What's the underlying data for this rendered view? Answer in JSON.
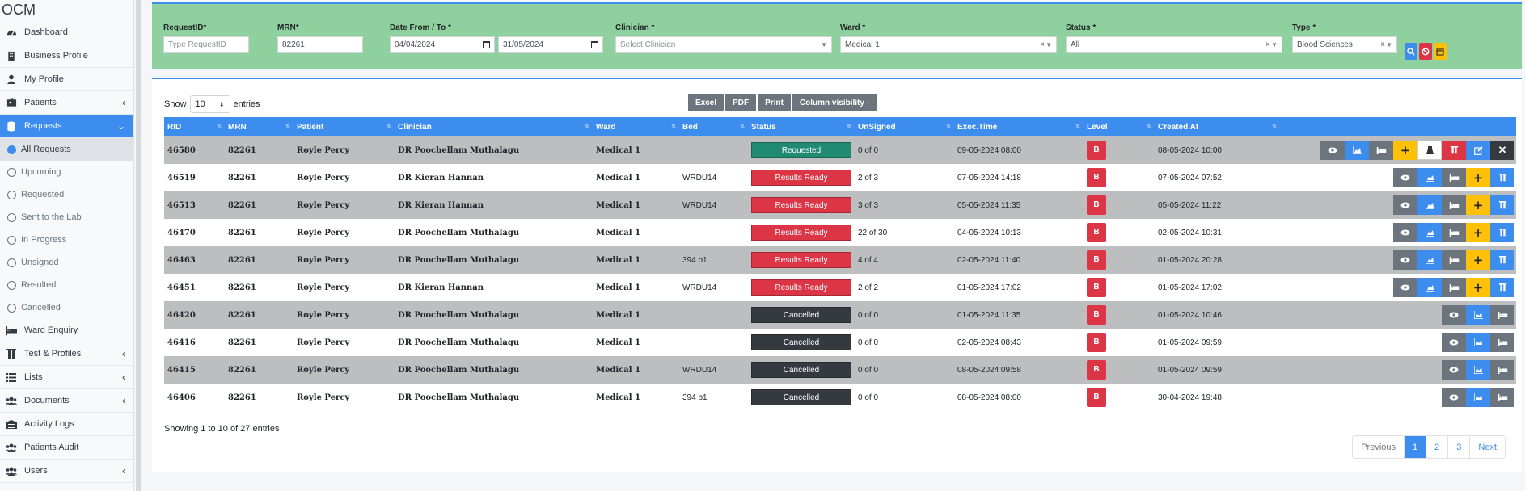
{
  "brand": "OCM",
  "sidebar": {
    "items": [
      {
        "label": "Dashboard",
        "icon": "dashboard-icon"
      },
      {
        "label": "Business Profile",
        "icon": "building-icon"
      },
      {
        "label": "My Profile",
        "icon": "user-icon"
      },
      {
        "label": "Patients",
        "icon": "patients-icon",
        "chevron": "‹"
      },
      {
        "label": "Requests",
        "icon": "database-icon",
        "chevron": "⌄"
      }
    ],
    "sub_items": [
      {
        "label": "All Requests"
      },
      {
        "label": "Upcoming"
      },
      {
        "label": "Requested"
      },
      {
        "label": "Sent to the Lab"
      },
      {
        "label": "In Progress"
      },
      {
        "label": "Unsigned"
      },
      {
        "label": "Resulted"
      },
      {
        "label": "Cancelled"
      }
    ],
    "items_after": [
      {
        "label": "Ward Enquiry",
        "icon": "bed-icon"
      },
      {
        "label": "Test & Profiles",
        "icon": "test-tubes-icon",
        "chevron": "‹"
      },
      {
        "label": "Lists",
        "icon": "list-icon",
        "chevron": "‹"
      },
      {
        "label": "Documents",
        "icon": "users-icon",
        "chevron": "‹"
      },
      {
        "label": "Activity Logs",
        "icon": "warehouse-icon"
      },
      {
        "label": "Patients Audit",
        "icon": "users-icon"
      },
      {
        "label": "Users",
        "icon": "users-icon",
        "chevron": "‹"
      }
    ]
  },
  "filters": {
    "request_id": {
      "label": "RequestID*",
      "placeholder": "Type RequestID",
      "value": ""
    },
    "mrn": {
      "label": "MRN*",
      "value": "82261"
    },
    "date": {
      "label": "Date From / To *",
      "from": "04/04/2024",
      "to": "31/05/2024"
    },
    "clinician": {
      "label": "Clinician *",
      "placeholder": "Select Clinician"
    },
    "ward": {
      "label": "Ward *",
      "value": "Medical 1"
    },
    "status": {
      "label": "Status *",
      "value": "All"
    },
    "type": {
      "label": "Type *",
      "value": "Blood Sciences"
    }
  },
  "table_controls": {
    "show": "Show",
    "entries_value": "10",
    "entries": "entries",
    "buttons": [
      "Excel",
      "PDF",
      "Print",
      "Column visibility -"
    ]
  },
  "columns": [
    "RID",
    "MRN",
    "Patient",
    "Clinician",
    "Ward",
    "Bed",
    "Status",
    "UnSigned",
    "Exec.Time",
    "Level",
    "Created At",
    ""
  ],
  "rows": [
    {
      "rid": "46580",
      "mrn": "82261",
      "patient": "Royle Percy",
      "clinician": "DR Poochellam Muthalagu",
      "ward": "Medical 1",
      "bed": "",
      "status": "Requested",
      "unsigned": "0 of 0",
      "exec": "09-05-2024 08:00",
      "level": "B",
      "created": "08-05-2024 10:00"
    },
    {
      "rid": "46519",
      "mrn": "82261",
      "patient": "Royle Percy",
      "clinician": "DR Kieran Hannan",
      "ward": "Medical 1",
      "bed": "WRDU14",
      "status": "Results Ready",
      "unsigned": "2 of 3",
      "exec": "07-05-2024 14:18",
      "level": "B",
      "created": "07-05-2024 07:52"
    },
    {
      "rid": "46513",
      "mrn": "82261",
      "patient": "Royle Percy",
      "clinician": "DR Kieran Hannan",
      "ward": "Medical 1",
      "bed": "WRDU14",
      "status": "Results Ready",
      "unsigned": "3 of 3",
      "exec": "05-05-2024 11:35",
      "level": "B",
      "created": "05-05-2024 11:22"
    },
    {
      "rid": "46470",
      "mrn": "82261",
      "patient": "Royle Percy",
      "clinician": "DR Poochellam Muthalagu",
      "ward": "Medical 1",
      "bed": "",
      "status": "Results Ready",
      "unsigned": "22 of 30",
      "exec": "04-05-2024 10:13",
      "level": "B",
      "created": "02-05-2024 10:31"
    },
    {
      "rid": "46463",
      "mrn": "82261",
      "patient": "Royle Percy",
      "clinician": "DR Poochellam Muthalagu",
      "ward": "Medical 1",
      "bed": "394 b1",
      "status": "Results Ready",
      "unsigned": "4 of 4",
      "exec": "02-05-2024 11:40",
      "level": "B",
      "created": "01-05-2024 20:28"
    },
    {
      "rid": "46451",
      "mrn": "82261",
      "patient": "Royle Percy",
      "clinician": "DR Kieran Hannan",
      "ward": "Medical 1",
      "bed": "WRDU14",
      "status": "Results Ready",
      "unsigned": "2 of 2",
      "exec": "01-05-2024 17:02",
      "level": "B",
      "created": "01-05-2024 17:02"
    },
    {
      "rid": "46420",
      "mrn": "82261",
      "patient": "Royle Percy",
      "clinician": "DR Poochellam Muthalagu",
      "ward": "Medical 1",
      "bed": "",
      "status": "Cancelled",
      "unsigned": "0 of 0",
      "exec": "01-05-2024 11:35",
      "level": "B",
      "created": "01-05-2024 10:46"
    },
    {
      "rid": "46416",
      "mrn": "82261",
      "patient": "Royle Percy",
      "clinician": "DR Poochellam Muthalagu",
      "ward": "Medical 1",
      "bed": "",
      "status": "Cancelled",
      "unsigned": "0 of 0",
      "exec": "02-05-2024 08:43",
      "level": "B",
      "created": "01-05-2024 09:59"
    },
    {
      "rid": "46415",
      "mrn": "82261",
      "patient": "Royle Percy",
      "clinician": "DR Poochellam Muthalagu",
      "ward": "Medical 1",
      "bed": "WRDU14",
      "status": "Cancelled",
      "unsigned": "0 of 0",
      "exec": "08-05-2024 09:58",
      "level": "B",
      "created": "01-05-2024 09:59"
    },
    {
      "rid": "46406",
      "mrn": "82261",
      "patient": "Royle Percy",
      "clinician": "DR Poochellam Muthalagu",
      "ward": "Medical 1",
      "bed": "394 b1",
      "status": "Cancelled",
      "unsigned": "0 of 0",
      "exec": "08-05-2024 08:00",
      "level": "B",
      "created": "30-04-2024 19:48"
    }
  ],
  "info": "Showing 1 to 10 of 27 entries",
  "pagination": [
    "Previous",
    "1",
    "2",
    "3",
    "Next"
  ],
  "colors": {
    "accent": "#3c8dee",
    "filter_bg": "#8fd19e",
    "danger": "#dc3545",
    "requested": "#218a72",
    "cancelled": "#343a40",
    "warning": "#ffc107"
  }
}
